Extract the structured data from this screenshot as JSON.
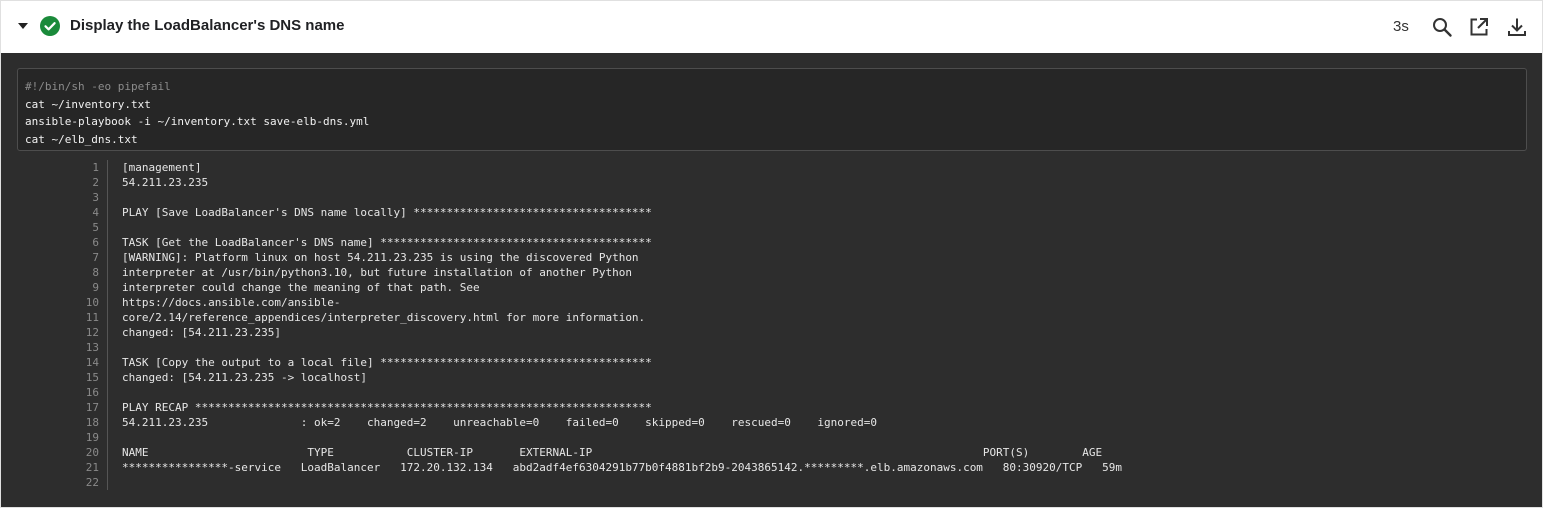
{
  "step": {
    "title": "Display the LoadBalancer's DNS name",
    "duration": "3s",
    "status": "success",
    "status_color": "#1a8a3a",
    "icons": [
      "chevron-down-icon",
      "check-circle-icon",
      "search-icon",
      "open-external-icon",
      "download-icon"
    ]
  },
  "command": {
    "shebang": "#!/bin/sh -eo pipefail",
    "line1": "cat ~/inventory.txt",
    "line2": "ansible-playbook -i ~/inventory.txt save-elb-dns.yml",
    "line3": "cat ~/elb_dns.txt"
  },
  "output": {
    "lines": [
      {
        "n": "1",
        "text": "[management]"
      },
      {
        "n": "2",
        "text": "54.211.23.235"
      },
      {
        "n": "3",
        "text": ""
      },
      {
        "n": "4",
        "text": "PLAY [Save LoadBalancer's DNS name locally] ************************************"
      },
      {
        "n": "5",
        "text": ""
      },
      {
        "n": "6",
        "text": "TASK [Get the LoadBalancer's DNS name] *****************************************"
      },
      {
        "n": "7",
        "text": "[WARNING]: Platform linux on host 54.211.23.235 is using the discovered Python"
      },
      {
        "n": "8",
        "text": "interpreter at /usr/bin/python3.10, but future installation of another Python"
      },
      {
        "n": "9",
        "text": "interpreter could change the meaning of that path. See"
      },
      {
        "n": "10",
        "text": "https://docs.ansible.com/ansible-"
      },
      {
        "n": "11",
        "text": "core/2.14/reference_appendices/interpreter_discovery.html for more information."
      },
      {
        "n": "12",
        "text": "changed: [54.211.23.235]"
      },
      {
        "n": "13",
        "text": ""
      },
      {
        "n": "14",
        "text": "TASK [Copy the output to a local file] *****************************************"
      },
      {
        "n": "15",
        "text": "changed: [54.211.23.235 -> localhost]"
      },
      {
        "n": "16",
        "text": ""
      },
      {
        "n": "17",
        "text": "PLAY RECAP *********************************************************************"
      },
      {
        "n": "18",
        "text": "54.211.23.235              : ok=2    changed=2    unreachable=0    failed=0    skipped=0    rescued=0    ignored=0"
      },
      {
        "n": "19",
        "text": ""
      },
      {
        "n": "20",
        "text": "NAME                        TYPE           CLUSTER-IP       EXTERNAL-IP                                                           PORT(S)        AGE"
      },
      {
        "n": "21",
        "text": "****************-service   LoadBalancer   172.20.132.134   abd2adf4ef6304291b77b0f4881bf2b9-2043865142.*********.elb.amazonaws.com   80:30920/TCP   59m"
      },
      {
        "n": "22",
        "text": ""
      }
    ]
  }
}
